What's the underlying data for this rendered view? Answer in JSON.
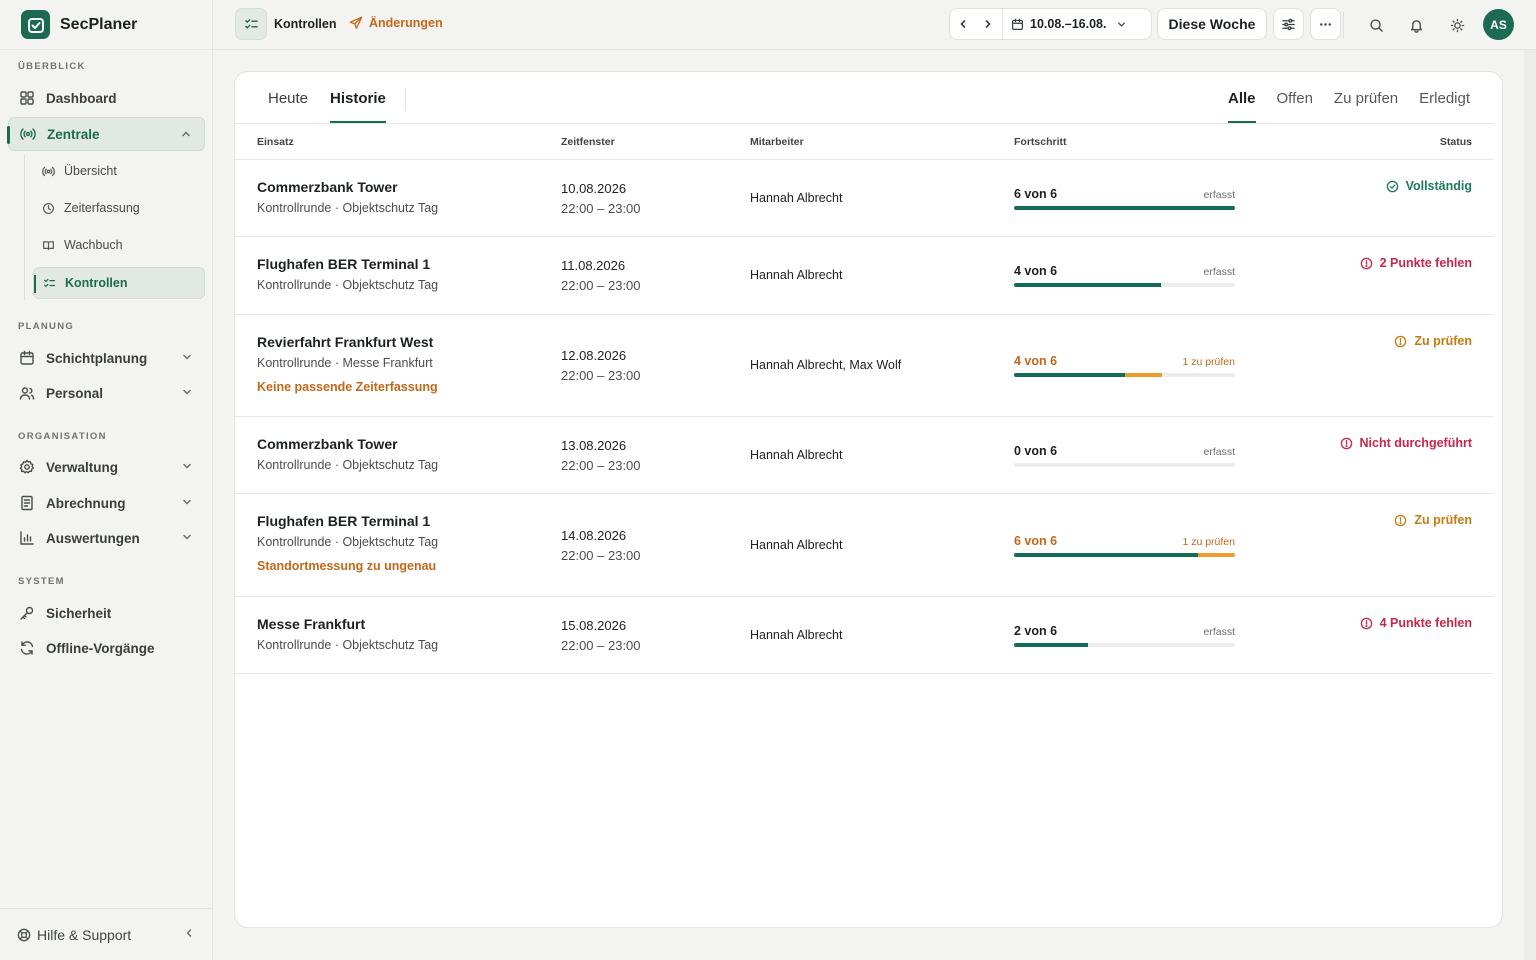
{
  "app": {
    "name": "SecPlaner",
    "brand_color": "#1d6a52"
  },
  "sidebar": {
    "sections": {
      "overview": "ÜBERBLICK",
      "planning": "PLANUNG",
      "organisation": "ORGANISATION",
      "system": "SYSTEM"
    },
    "items": {
      "dashboard": "Dashboard",
      "zentrale": "Zentrale",
      "uebersicht": "Übersicht",
      "zeiterfassung": "Zeiterfassung",
      "wachbuch": "Wachbuch",
      "kontrollen": "Kontrollen",
      "schichtplanung": "Schichtplanung",
      "personal": "Personal",
      "verwaltung": "Verwaltung",
      "abrechnung": "Abrechnung",
      "auswertungen": "Auswertungen",
      "sicherheit": "Sicherheit",
      "offline": "Offline-Vorgänge"
    },
    "footer": "Hilfe & Support"
  },
  "topbar": {
    "title": "Kontrollen",
    "changes": "Änderungen",
    "date_range": "10.08.–16.08.",
    "this_week": "Diese Woche",
    "avatar": "AS"
  },
  "tabs": {
    "today": "Heute",
    "history": "Historie"
  },
  "filters": {
    "all": "Alle",
    "open": "Offen",
    "review": "Zu prüfen",
    "done": "Erledigt"
  },
  "columns": {
    "einsatz": "Einsatz",
    "zeitfenster": "Zeitfenster",
    "mitarbeiter": "Mitarbeiter",
    "fortschritt": "Fortschritt",
    "status": "Status"
  },
  "rows": [
    {
      "title": "Commerzbank Tower",
      "sub": "Kontrollrunde · Objektschutz Tag",
      "warn": "",
      "date": "10.08.2026",
      "time": "22:00 – 23:00",
      "employee": "Hannah Albrecht",
      "progress": "6 von 6",
      "note": "erfasst",
      "done": 6,
      "review": 0,
      "total": 6,
      "status": "Vollständig",
      "status_type": "green"
    },
    {
      "title": "Flughafen BER Terminal 1",
      "sub": "Kontrollrunde · Objektschutz Tag",
      "warn": "",
      "date": "11.08.2026",
      "time": "22:00 – 23:00",
      "employee": "Hannah Albrecht",
      "progress": "4 von 6",
      "note": "erfasst",
      "done": 4,
      "review": 0,
      "total": 6,
      "status": "2 Punkte fehlen",
      "status_type": "red"
    },
    {
      "title": "Revierfahrt Frankfurt West",
      "sub": "Kontrollrunde · Messe Frankfurt",
      "warn": "Keine passende Zeiterfassung",
      "date": "12.08.2026",
      "time": "22:00 – 23:00",
      "employee": "Hannah Albrecht, Max Wolf",
      "progress": "4 von 6",
      "note": "1 zu prüfen",
      "done": 3,
      "review": 1,
      "total": 6,
      "status": "Zu prüfen",
      "status_type": "orange"
    },
    {
      "title": "Commerzbank Tower",
      "sub": "Kontrollrunde · Objektschutz Tag",
      "warn": "",
      "date": "13.08.2026",
      "time": "22:00 – 23:00",
      "employee": "Hannah Albrecht",
      "progress": "0 von 6",
      "note": "erfasst",
      "done": 0,
      "review": 0,
      "total": 6,
      "status": "Nicht durchgeführt",
      "status_type": "red"
    },
    {
      "title": "Flughafen BER Terminal 1",
      "sub": "Kontrollrunde · Objektschutz Tag",
      "warn": "Standortmessung zu ungenau",
      "date": "14.08.2026",
      "time": "22:00 – 23:00",
      "employee": "Hannah Albrecht",
      "progress": "6 von 6",
      "note": "1 zu prüfen",
      "done": 5,
      "review": 1,
      "total": 6,
      "status": "Zu prüfen",
      "status_type": "orange"
    },
    {
      "title": "Messe Frankfurt",
      "sub": "Kontrollrunde · Objektschutz Tag",
      "warn": "",
      "date": "15.08.2026",
      "time": "22:00 – 23:00",
      "employee": "Hannah Albrecht",
      "progress": "2 von 6",
      "note": "erfasst",
      "done": 2,
      "review": 0,
      "total": 6,
      "status": "4 Punkte fehlen",
      "status_type": "red"
    }
  ]
}
